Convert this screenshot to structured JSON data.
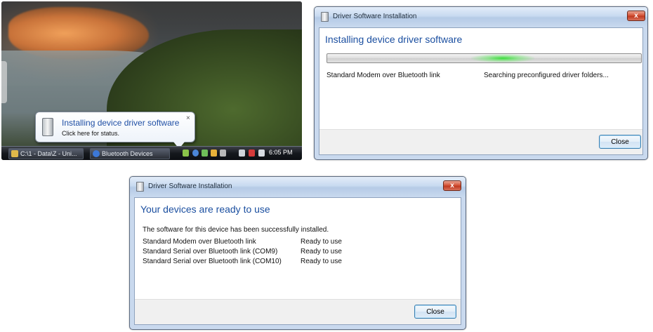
{
  "taskbar_scene": {
    "balloon": {
      "title": "Installing device driver software",
      "subtitle": "Click here for status.",
      "close_glyph": "×",
      "icon": "device-icon"
    },
    "taskbar": {
      "buttons": [
        {
          "label": "C:\\1 - Data\\Z - Uni...",
          "icon": "folder-icon"
        },
        {
          "label": "Bluetooth Devices",
          "icon": "bluetooth-icon"
        }
      ],
      "clock": "6:05 PM"
    }
  },
  "dialog_installing": {
    "title": "Driver Software Installation",
    "close_glyph": "x",
    "heading": "Installing device driver software",
    "device_name": "Standard Modem over Bluetooth link",
    "status": "Searching preconfigured driver folders...",
    "close_label": "Close"
  },
  "dialog_ready": {
    "title": "Driver Software Installation",
    "close_glyph": "x",
    "heading": "Your devices are ready to use",
    "message": "The software for this device has been successfully installed.",
    "devices": [
      {
        "name": "Standard Modem over Bluetooth link",
        "status": "Ready to use"
      },
      {
        "name": "Standard Serial over Bluetooth link (COM9)",
        "status": "Ready to use"
      },
      {
        "name": "Standard Serial over Bluetooth link (COM10)",
        "status": "Ready to use"
      }
    ],
    "close_label": "Close"
  },
  "colors": {
    "heading_blue": "#1b4fa0",
    "progress_glow": "#3ddc3d",
    "close_x_red": "#c13a20"
  }
}
